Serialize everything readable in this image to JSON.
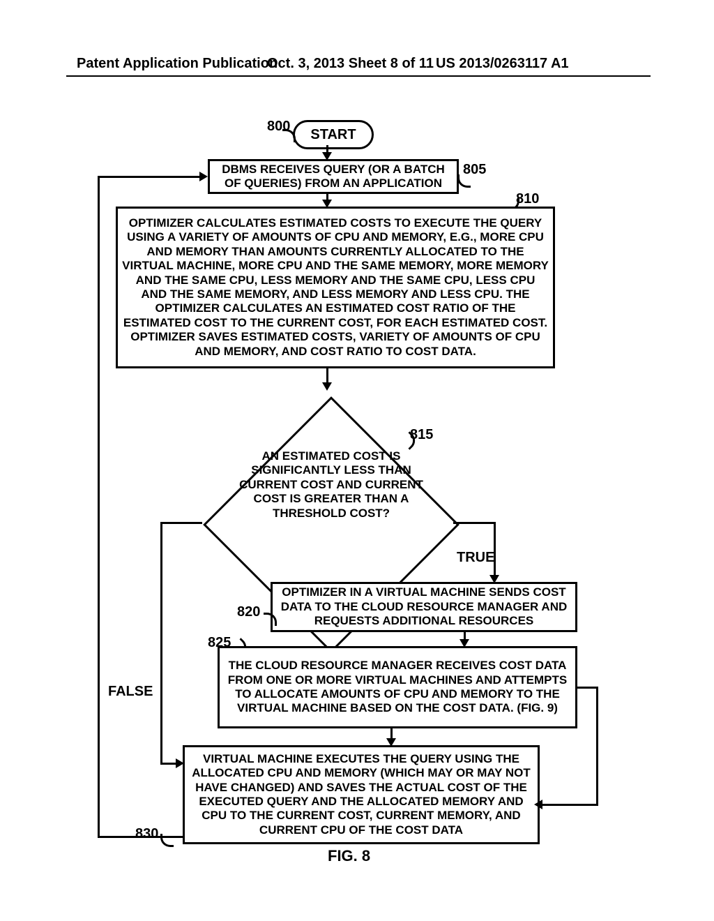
{
  "header": {
    "left": "Patent Application Publication",
    "center": "Oct. 3, 2013   Sheet 8 of 11",
    "right": "US 2013/0263117 A1"
  },
  "ref": {
    "r800": "800",
    "r805": "805",
    "r810": "810",
    "r815": "815",
    "r820": "820",
    "r825": "825",
    "r830": "830"
  },
  "labels": {
    "start": "START",
    "true": "TRUE",
    "false": "FALSE",
    "fig": "FIG. 8"
  },
  "boxes": {
    "b805": "DBMS RECEIVES QUERY (OR A BATCH OF QUERIES) FROM AN APPLICATION",
    "b810": "OPTIMIZER CALCULATES ESTIMATED COSTS TO EXECUTE THE QUERY USING A VARIETY OF AMOUNTS OF CPU AND MEMORY, E.G., MORE CPU AND MEMORY THAN AMOUNTS CURRENTLY ALLOCATED TO THE VIRTUAL MACHINE, MORE CPU AND THE SAME MEMORY, MORE MEMORY AND THE SAME CPU, LESS MEMORY AND THE SAME CPU, LESS CPU AND THE SAME MEMORY, AND LESS MEMORY AND LESS CPU.  THE OPTIMIZER CALCULATES AN ESTIMATED COST RATIO OF THE ESTIMATED COST TO THE CURRENT COST, FOR EACH ESTIMATED COST.  OPTIMIZER SAVES ESTIMATED COSTS, VARIETY OF AMOUNTS OF CPU AND MEMORY, AND COST RATIO TO COST DATA.",
    "d815": "AN ESTIMATED COST IS SIGNIFICANTLY LESS THAN CURRENT COST AND CURRENT COST IS GREATER THAN A THRESHOLD COST?",
    "b820": "OPTIMIZER IN A VIRTUAL MACHINE SENDS COST DATA TO THE CLOUD RESOURCE MANAGER AND REQUESTS ADDITIONAL RESOURCES",
    "b825": "THE CLOUD RESOURCE MANAGER RECEIVES COST DATA FROM ONE OR MORE VIRTUAL MACHINES AND ATTEMPTS TO ALLOCATE AMOUNTS OF CPU AND MEMORY TO THE VIRTUAL MACHINE BASED ON THE COST DATA. (FIG. 9)",
    "b830": "VIRTUAL MACHINE EXECUTES THE QUERY USING THE ALLOCATED CPU AND MEMORY (WHICH MAY OR MAY NOT HAVE CHANGED) AND SAVES THE ACTUAL COST OF THE EXECUTED QUERY AND THE ALLOCATED MEMORY AND CPU TO THE CURRENT COST, CURRENT MEMORY, AND CURRENT CPU OF THE COST DATA"
  }
}
